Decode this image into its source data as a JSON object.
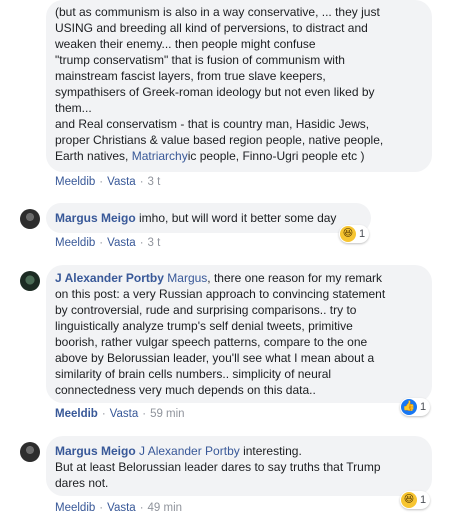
{
  "comments": [
    {
      "lines": [
        "(but as communism is also in a way conservative, ... they just",
        "USING and breeding all kind of perversions, to distract and",
        "weaken their enemy... then people might confuse",
        "\"trump conservatism\" that is fusion of communism with",
        "mainstream fascist layers, from true slave keepers,",
        "sympathisers of Greek-roman ideology but not even liked by",
        "them...",
        "and Real conservatism - that is country man, Hasidic Jews,",
        "proper Christians & value based region people, native people,"
      ],
      "last_line_pre": "Earth natives, ",
      "last_line_link": "Matriarchy",
      "last_line_post": "ic people, Finno-Ugri people etc )",
      "like": "Meeldib",
      "reply": "Vasta",
      "time": "3 t"
    },
    {
      "author": "Margus Meigo",
      "text": "imho, but will word it better some day",
      "like": "Meeldib",
      "reply": "Vasta",
      "time": "3 t",
      "reaction_icon": "haha-emoji",
      "reaction_count": "1"
    },
    {
      "author": "J Alexander Portby",
      "mention": "Margus",
      "first_line_rest": ", there one reason for my remark",
      "lines": [
        "on this post: a very Russian approach to convincing statement",
        "by controversial, rude and surprising comparisons.. try to",
        "linguistically analyze trump's self denial tweets, primitive",
        "boorish, rather vulgar speech patterns, compare to the one",
        "above by Belorussian leader, you'll see what I mean about a",
        "similarity of brain cells numbers.. simplicity of neural",
        "connectedness very much depends on this data.."
      ],
      "like": "Meeldib",
      "reply": "Vasta",
      "time": "59 min",
      "reaction_icon": "like-icon",
      "reaction_count": "1"
    },
    {
      "author": "Margus Meigo",
      "mention": "J Alexander Portby",
      "first_line_rest": " interesting.",
      "lines": [
        "But at least Belorussian leader dares to say truths that Trump",
        "dares not."
      ],
      "like": "Meeldib",
      "reply": "Vasta",
      "time": "49 min",
      "reaction_icon": "haha-emoji",
      "reaction_count": "1"
    }
  ]
}
